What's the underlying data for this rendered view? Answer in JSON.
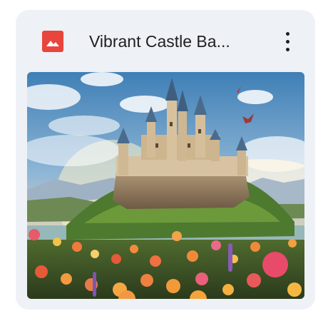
{
  "file_card": {
    "title": "Vibrant Castle Ba...",
    "file_type_icon": "image-file-icon",
    "menu_icon": "more-vert-icon",
    "thumbnail_icon": "castle-landscape-thumbnail",
    "accent_color": "#e8453c"
  }
}
